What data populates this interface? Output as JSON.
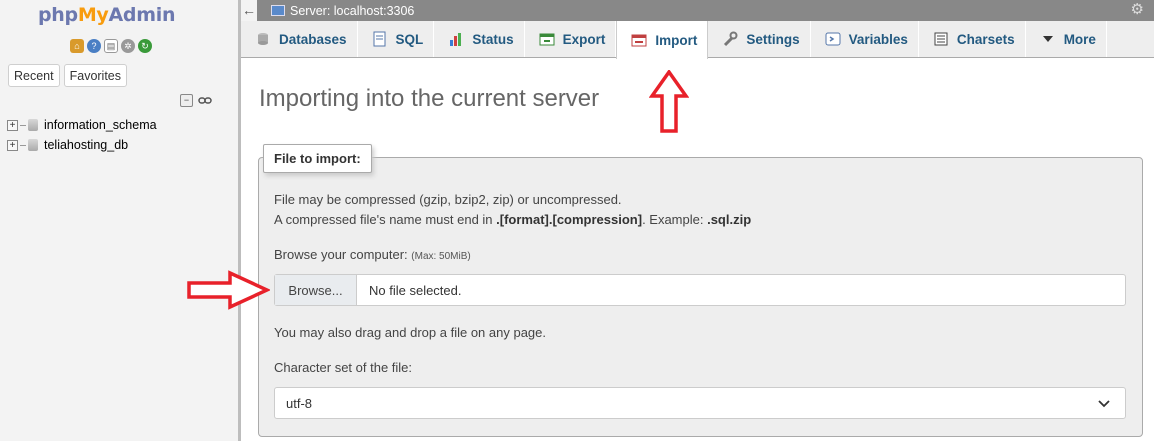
{
  "logo": {
    "php": "php",
    "my": "My",
    "admin": "Admin"
  },
  "logo_icons": [
    "home-icon",
    "help-icon",
    "docs-icon",
    "settings-icon",
    "reload-icon"
  ],
  "sidebar": {
    "tabs": [
      "Recent",
      "Favorites"
    ],
    "databases": [
      "information_schema",
      "teliahosting_db"
    ]
  },
  "topbar": {
    "server": "Server: localhost:3306"
  },
  "menu": [
    {
      "label": "Databases",
      "icon": "database-icon"
    },
    {
      "label": "SQL",
      "icon": "sql-icon"
    },
    {
      "label": "Status",
      "icon": "status-icon"
    },
    {
      "label": "Export",
      "icon": "export-icon"
    },
    {
      "label": "Import",
      "icon": "import-icon",
      "active": true
    },
    {
      "label": "Settings",
      "icon": "wrench-icon"
    },
    {
      "label": "Variables",
      "icon": "variables-icon"
    },
    {
      "label": "Charsets",
      "icon": "charsets-icon"
    },
    {
      "label": "More",
      "icon": "triangle-down-icon"
    }
  ],
  "main": {
    "title": "Importing into the current server",
    "fieldset_legend": "File to import:",
    "compression_line1": "File may be compressed (gzip, bzip2, zip) or uncompressed.",
    "compression_line2_a": "A compressed file's name must end in ",
    "compression_line2_b": ".[format].[compression]",
    "compression_line2_c": ". Example: ",
    "compression_line2_d": ".sql.zip",
    "browse_label": "Browse your computer: ",
    "max_size": "(Max: 50MiB)",
    "browse_button": "Browse...",
    "file_status": "No file selected.",
    "drag_drop": "You may also drag and drop a file on any page.",
    "charset_label": "Character set of the file:",
    "charset_value": "utf-8"
  },
  "colors": {
    "accent": "#235a81",
    "annotation_arrow": "#e8212a",
    "topbar": "#888888"
  }
}
